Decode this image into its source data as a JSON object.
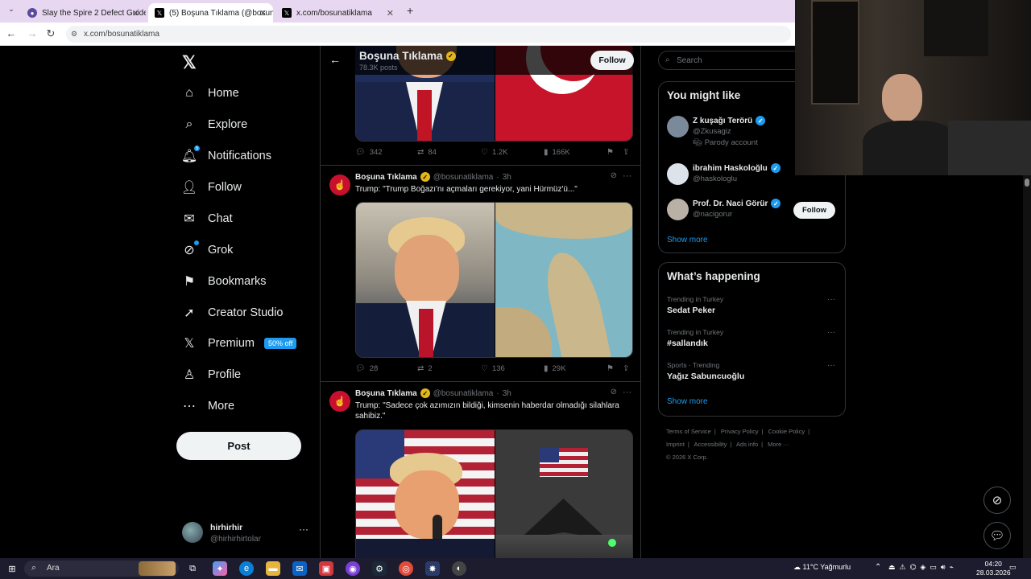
{
  "browser": {
    "tabs": [
      {
        "label": "Slay the Spire 2 Defect Guide -",
        "active": false
      },
      {
        "label": "(5) Boşuna Tıklama (@bosunati",
        "active": true
      },
      {
        "label": "x.com/bosunatiklama",
        "active": false
      }
    ],
    "address": "x.com/bosunatiklama",
    "new_tab_icon": "plus-icon"
  },
  "nav": {
    "items": [
      {
        "label": "Home",
        "icon": "home-icon"
      },
      {
        "label": "Explore",
        "icon": "search-icon"
      },
      {
        "label": "Notifications",
        "icon": "bell-icon",
        "badge": "5"
      },
      {
        "label": "Follow",
        "icon": "person-add-icon"
      },
      {
        "label": "Chat",
        "icon": "mail-icon"
      },
      {
        "label": "Grok",
        "icon": "grok-icon"
      },
      {
        "label": "Bookmarks",
        "icon": "bookmark-icon"
      },
      {
        "label": "Creator Studio",
        "icon": "rocket-icon"
      },
      {
        "label": "Premium",
        "icon": "x-icon",
        "promo": "50% off"
      },
      {
        "label": "Profile",
        "icon": "person-icon"
      },
      {
        "label": "More",
        "icon": "more-circle-icon"
      }
    ],
    "post_label": "Post",
    "account": {
      "name": "hirhirhir",
      "handle": "@hirhirhirtolar"
    }
  },
  "profile_header": {
    "name": "Boşuna Tıklama",
    "posts": "78.3K posts",
    "follow_label": "Follow"
  },
  "posts": [
    {
      "stats": {
        "replies": "342",
        "reposts": "84",
        "likes": "1.2K",
        "views": "166K"
      }
    },
    {
      "author": "Boşuna Tıklama",
      "handle": "@bosunatiklama",
      "time": "3h",
      "text": "Trump: \"Trump Boğazı'nı açmaları gerekiyor, yani Hürmüz'ü...\"",
      "stats": {
        "replies": "28",
        "reposts": "2",
        "likes": "136",
        "views": "29K"
      }
    },
    {
      "author": "Boşuna Tıklama",
      "handle": "@bosunatiklama",
      "time": "3h",
      "text": "Trump: \"Sadece çok azımızın bildiği, kimsenin haberdar olmadığı silahlara sahibiz.\""
    }
  ],
  "right": {
    "search_placeholder": "Search",
    "you_might_like": {
      "title": "You might like",
      "users": [
        {
          "name": "Z kuşağı Terörü",
          "handle": "@Zkusagiz",
          "extra": "Parody account"
        },
        {
          "name": "ibrahim Haskoloğlu",
          "handle": "@haskologlu"
        },
        {
          "name": "Prof. Dr. Naci Görür",
          "handle": "@nacigorur",
          "follow_label": "Follow"
        }
      ],
      "show_more": "Show more"
    },
    "whats_happening": {
      "title": "What’s happening",
      "trends": [
        {
          "context": "Trending in Turkey",
          "topic": "Sedat Peker"
        },
        {
          "context": "Trending in Turkey",
          "topic": "#sallandık"
        },
        {
          "context": "Sports · Trending",
          "topic": "Yağız Sabuncuoğlu"
        }
      ],
      "show_more": "Show more"
    },
    "footer": [
      "Terms of Service",
      "|",
      "Privacy Policy",
      "|",
      "Cookie Policy",
      "|",
      "Imprint",
      "|",
      "Accessibility",
      "|",
      "Ads info",
      "|",
      "More ···",
      "© 2026 X Corp."
    ]
  },
  "taskbar": {
    "search": "Ara",
    "weather": "11°C  Yağmurlu",
    "time": "04:20",
    "date": "28.03.2026"
  },
  "colors": {
    "accent": "#1d9bf0",
    "gold_check": "#e2b719",
    "bg": "#000000",
    "border": "#2f3336",
    "muted": "#71767b"
  }
}
